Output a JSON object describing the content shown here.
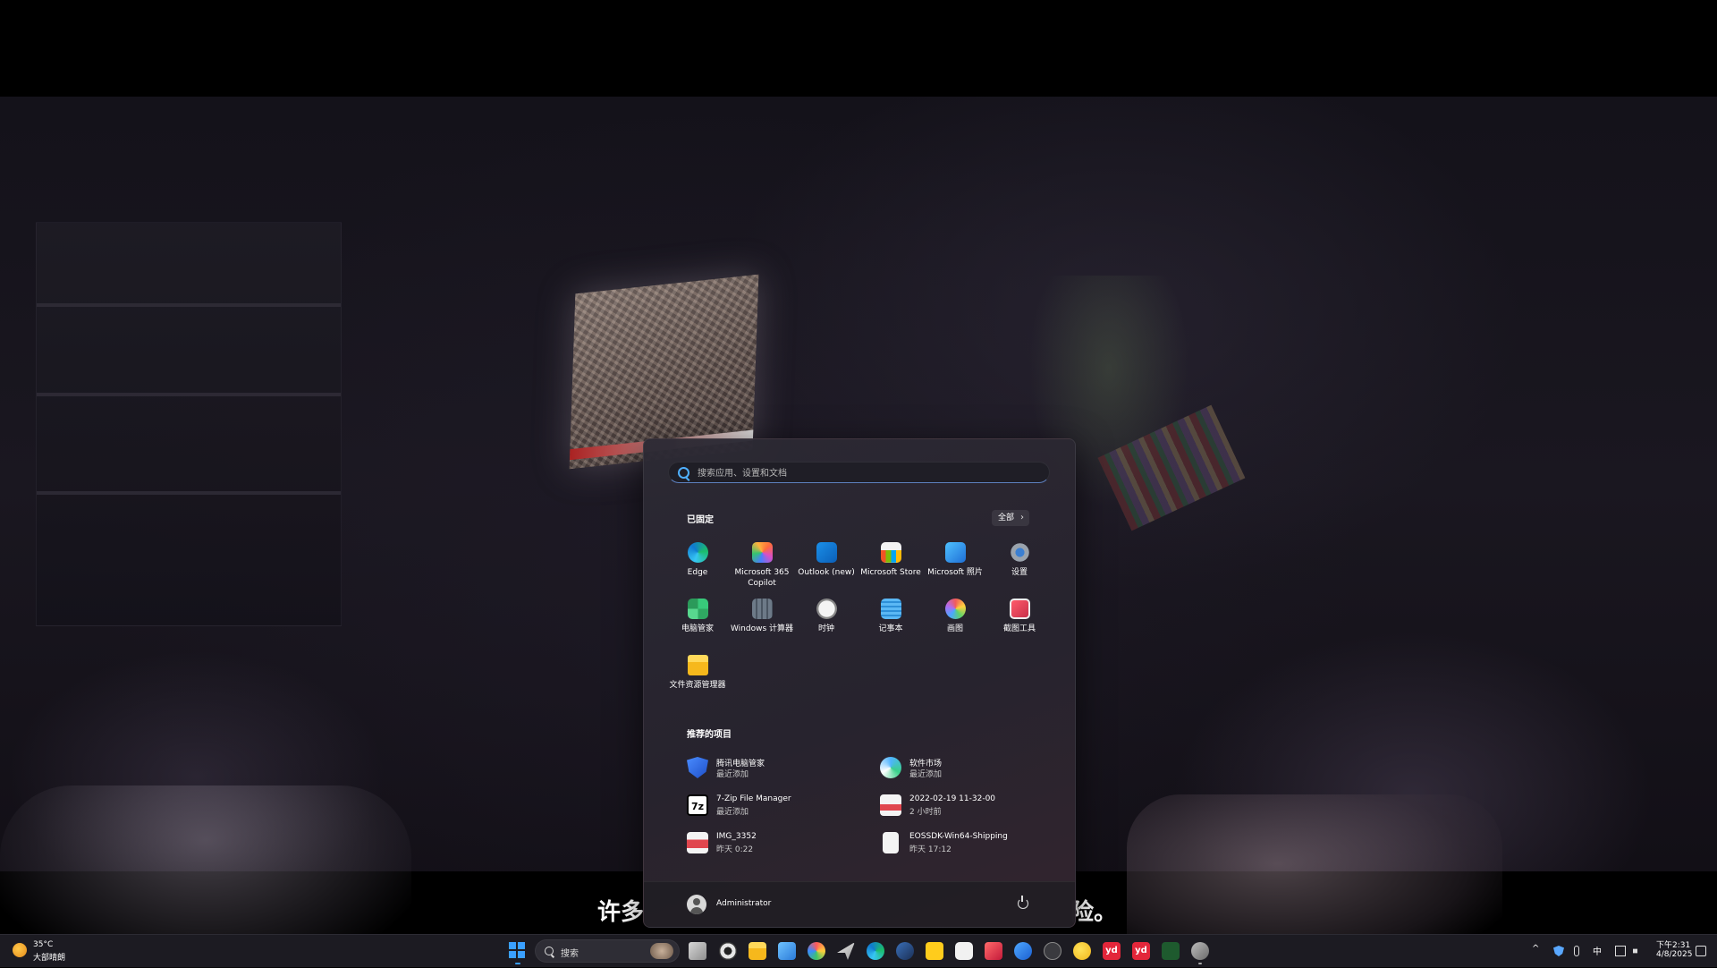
{
  "start_menu": {
    "search_placeholder": "搜索应用、设置和文档",
    "pinned_title": "已固定",
    "all_label": "全部",
    "pinned_apps": [
      {
        "label": "Edge",
        "icon": "edge-icon"
      },
      {
        "label": "Microsoft 365 Copilot",
        "icon": "m365-copilot-icon"
      },
      {
        "label": "Outlook (new)",
        "icon": "outlook-icon"
      },
      {
        "label": "Microsoft Store",
        "icon": "store-icon"
      },
      {
        "label": "Microsoft 照片",
        "icon": "photos-icon"
      },
      {
        "label": "设置",
        "icon": "settings-gear-icon"
      },
      {
        "label": "电脑管家",
        "icon": "pc-manager-icon"
      },
      {
        "label": "Windows 计算器",
        "icon": "calculator-icon"
      },
      {
        "label": "时钟",
        "icon": "clock-icon"
      },
      {
        "label": "记事本",
        "icon": "notepad-icon"
      },
      {
        "label": "画图",
        "icon": "paint-icon"
      },
      {
        "label": "截图工具",
        "icon": "snipping-tool-icon"
      },
      {
        "label": "文件资源管理器",
        "icon": "file-explorer-icon"
      }
    ],
    "recommended_title": "推荐的项目",
    "recommended": [
      {
        "name": "腾讯电脑管家",
        "sub": "最近添加",
        "icon": "tencent-pc-manager-icon"
      },
      {
        "name": "软件市场",
        "sub": "最近添加",
        "icon": "software-market-icon"
      },
      {
        "name": "7-Zip File Manager",
        "sub": "最近添加",
        "icon": "7zip-icon"
      },
      {
        "name": "2022-02-19 11-32-00",
        "sub": "2 小时前",
        "icon": "mp4-file-icon"
      },
      {
        "name": "IMG_3352",
        "sub": "昨天 0:22",
        "icon": "mp4-file-icon"
      },
      {
        "name": "EOSSDK-Win64-Shipping",
        "sub": "昨天 17:12",
        "icon": "generic-file-icon"
      }
    ],
    "user_name": "Administrator"
  },
  "subtitle": {
    "left": "许多",
    "right": "险。"
  },
  "taskbar": {
    "weather_temp": "35°C",
    "weather_desc": "大部晴朗",
    "search_label": "搜索",
    "input_indicator": "中",
    "clock_time": "下午2:31",
    "clock_date": "4/8/2025"
  },
  "colors": {
    "accent": "#3aa0ff",
    "menu_bg": "#2c2a34",
    "taskbar_bg": "#1c1b22"
  }
}
